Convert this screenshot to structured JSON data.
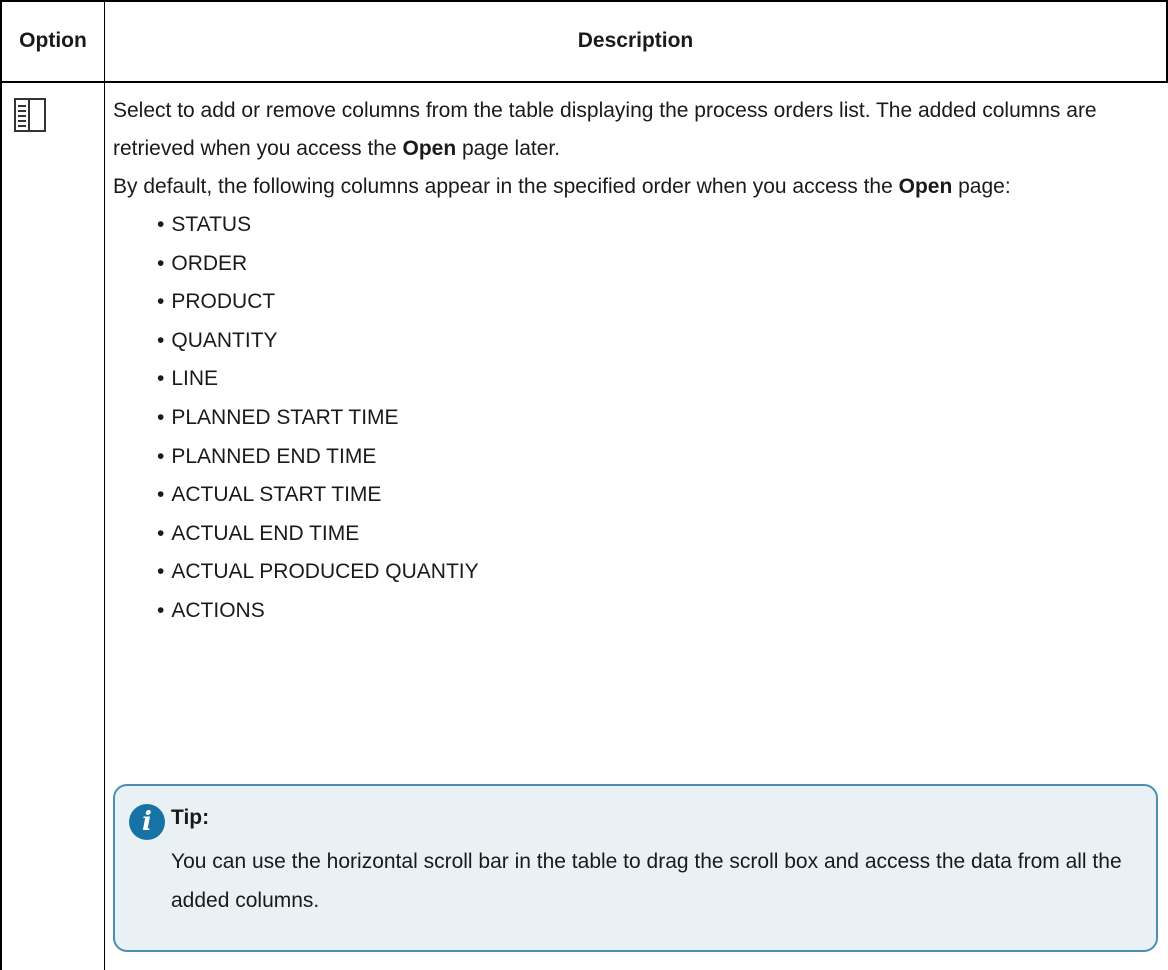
{
  "table": {
    "header_option": "Option",
    "header_description": "Description"
  },
  "row": {
    "icon": "column-settings-icon",
    "para1_pre": "Select to add or remove columns from the table displaying the process orders list. The added columns are retrieved when you access the ",
    "para1_bold": "Open",
    "para1_post": " page later.",
    "para2_pre": "By default, the following columns appear in the specified order when you access the ",
    "para2_bold": "Open",
    "para2_post": " page:",
    "columns": [
      "STATUS",
      "ORDER",
      "PRODUCT",
      "QUANTITY",
      "LINE",
      "PLANNED START TIME",
      "PLANNED END TIME",
      "ACTUAL START TIME",
      "ACTUAL END TIME",
      "ACTUAL PRODUCED QUANTIY",
      "ACTIONS"
    ]
  },
  "tip": {
    "title": "Tip:",
    "body": "You can use the horizontal scroll bar in the table to drag the scroll box and ac­cess the data from all the added columns.",
    "icon": "info-icon",
    "accent": "#1773a6",
    "border_color": "#4b8fb1",
    "background": "#e9f1f4"
  }
}
